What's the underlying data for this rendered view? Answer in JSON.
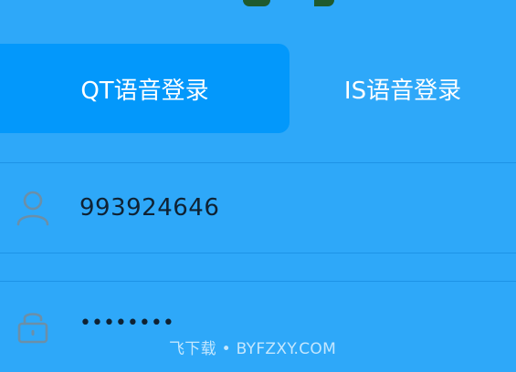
{
  "tabs": [
    {
      "label": "QT语音登录",
      "active": true
    },
    {
      "label": "IS语音登录",
      "active": false
    }
  ],
  "form": {
    "username": {
      "value": "993924646",
      "icon": "user-icon"
    },
    "password": {
      "value": "••••••••",
      "icon": "lock-icon"
    }
  },
  "watermark": "飞下载 • BYFZXY.COM",
  "colors": {
    "background": "#2ea8f9",
    "active_tab": "#0398fb",
    "text": "#ffffff",
    "input_text": "#0f2233",
    "icon": "#6b8fa8"
  }
}
